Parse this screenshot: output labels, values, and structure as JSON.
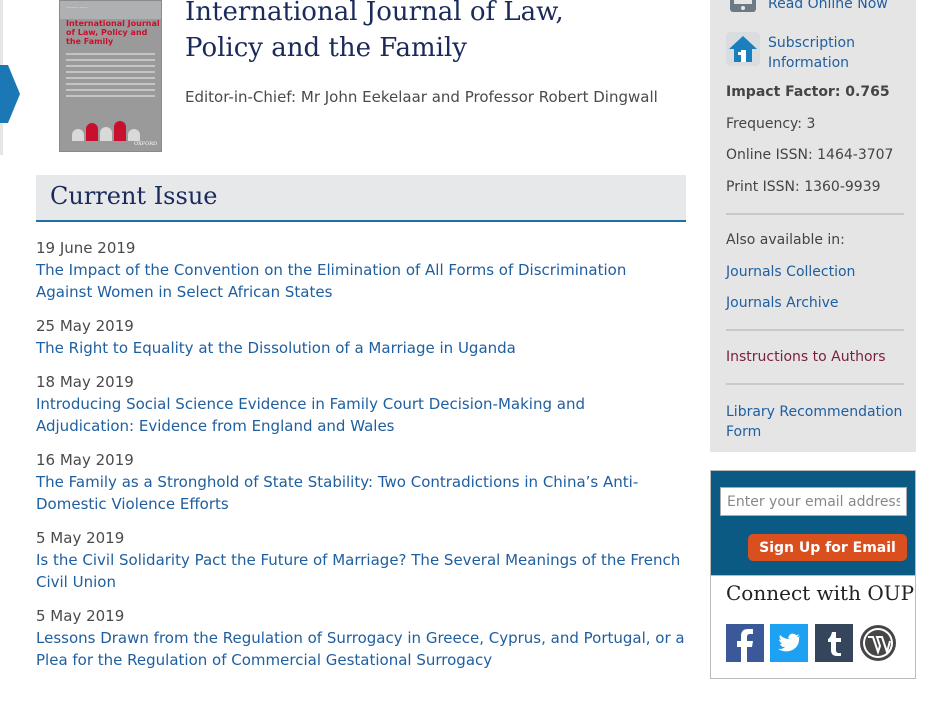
{
  "journal": {
    "title_line1": "International Journal of Law,",
    "title_line2": "Policy and the Family",
    "editors": "Editor-in-Chief: Mr John Eekelaar and Professor Robert Dingwall",
    "cover": {
      "title": "International Journal of Law, Policy and the Family",
      "publisher": "OXFORD"
    }
  },
  "current_issue": {
    "heading": "Current Issue",
    "items": [
      {
        "date": "19 June 2019",
        "title": "The Impact of the Convention on the Elimination of All Forms of Discrimination Against Women in Select African States"
      },
      {
        "date": "25 May 2019",
        "title": "The Right to Equality at the Dissolution of a Marriage in Uganda"
      },
      {
        "date": "18 May 2019",
        "title": "Introducing Social Science Evidence in Family Court Decision-Making and Adjudication: Evidence from England and Wales"
      },
      {
        "date": "16 May 2019",
        "title": "The Family as a Stronghold of State Stability: Two Contradictions in China’s Anti-Domestic Violence Efforts"
      },
      {
        "date": "5 May 2019",
        "title": "Is the Civil Solidarity Pact the Future of Marriage? The Several Meanings of the French Civil Union"
      },
      {
        "date": "5 May 2019",
        "title": "Lessons Drawn from the Regulation of Surrogacy in Greece, Cyprus, and Portugal, or a Plea for the Regulation of Commercial Gestational Surrogacy"
      }
    ]
  },
  "sidebar": {
    "read_online": "Read Online Now",
    "subscription": "Subscription Information",
    "impact_factor": "Impact Factor: 0.765",
    "frequency": "Frequency: 3",
    "online_issn": "Online ISSN: 1464-3707",
    "print_issn": "Print ISSN: 1360-9939",
    "also_available": "Also available in:",
    "journals_collection": "Journals Collection",
    "journals_archive": "Journals Archive",
    "instructions": "Instructions to Authors",
    "library_recommendation": "Library Recommendation Form"
  },
  "signup": {
    "placeholder": "Enter your email address",
    "button": "Sign Up for Email"
  },
  "connect": {
    "title": "Connect with OUP",
    "icons": [
      "facebook-icon",
      "twitter-icon",
      "tumblr-icon",
      "wordpress-icon"
    ]
  },
  "colors": {
    "link": "#1f5fa0",
    "heading": "#1a2a5a",
    "signup_bg": "#0b5a84",
    "signup_button": "#d94f1e",
    "arrow": "#1b78b4"
  }
}
